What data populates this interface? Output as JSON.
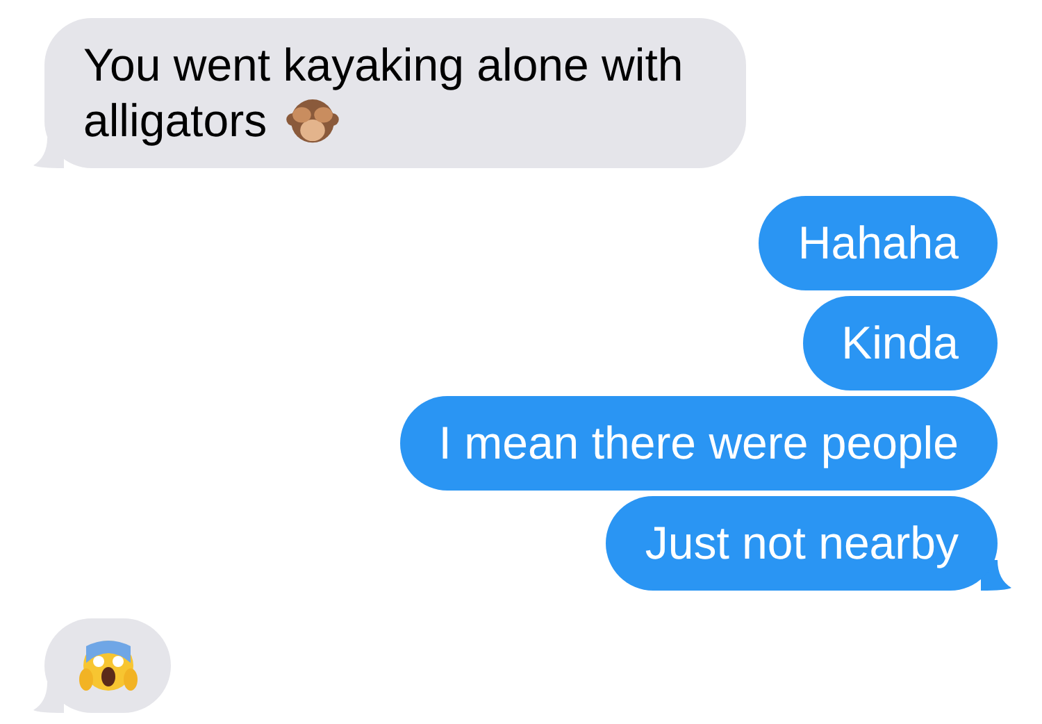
{
  "messages": [
    {
      "kind": "received",
      "text": "You went kayaking alone with alligators",
      "has_icon": true,
      "tail": true
    },
    {
      "kind": "sent",
      "text": "Hahaha",
      "has_icon": false,
      "tail": false
    },
    {
      "kind": "sent",
      "text": "Kinda",
      "has_icon": false,
      "tail": false
    },
    {
      "kind": "sent",
      "text": "I mean there were people",
      "has_icon": false,
      "tail": false
    },
    {
      "kind": "sent",
      "text": "Just not nearby",
      "has_icon": false,
      "tail": true
    },
    {
      "kind": "reaction",
      "tail": true
    }
  ]
}
